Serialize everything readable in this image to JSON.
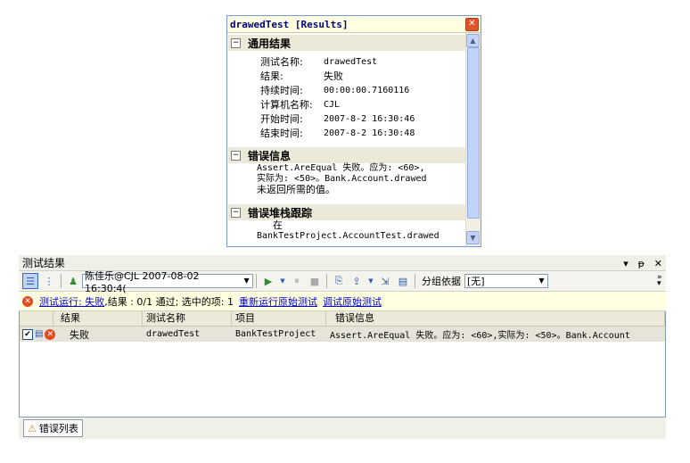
{
  "popup": {
    "title": "drawedTest [Results]",
    "close_glyph": "✕",
    "sections": {
      "general": {
        "title": "通用结果",
        "fields": [
          {
            "k": "测试名称:",
            "v": "drawedTest"
          },
          {
            "k": "结果:",
            "v": "失败"
          },
          {
            "k": "持续时间:",
            "v": "00:00:00.7160116"
          },
          {
            "k": "计算机名称:",
            "v": "CJL"
          },
          {
            "k": "开始时间:",
            "v": "2007-8-2 16:30:46"
          },
          {
            "k": "结束时间:",
            "v": "2007-8-2 16:30:48"
          }
        ]
      },
      "error": {
        "title": "错误信息",
        "line1": "Assert.AreEqual 失败。应为: <60>,",
        "line2": "实际为: <50>。Bank.Account.drawed",
        "line3": "未返回所需的值。"
      },
      "stack": {
        "title": "错误堆栈跟踪",
        "line1": "在",
        "line2": "BankTestProject.AccountTest.drawed"
      }
    }
  },
  "pane": {
    "title": "测试结果",
    "controls": {
      "dropdown": "▾",
      "pin": "ᵽ",
      "close": "✕"
    },
    "toolbar": {
      "run_selector": "陈佳乐@CJL 2007-08-02 16:30:4(",
      "group_by_label": "分组依据",
      "group_by_value": "[无]"
    },
    "status": {
      "run_link": "测试运行: 失败",
      "results_text": ",结果 : 0/1 通过;  选中的项: 1",
      "rerun_link": "重新运行原始测试",
      "debug_link": "调试原始测试"
    },
    "grid": {
      "columns": [
        "结果",
        "测试名称",
        "项目",
        "错误信息"
      ],
      "rows": [
        {
          "result": "失败",
          "name": "drawedTest",
          "project": "BankTestProject",
          "message": "Assert.AreEqual 失败。应为: <60>,实际为: <50>。Bank.Account"
        }
      ]
    },
    "bottom_tab": "错误列表"
  },
  "colors": {
    "accent": "#316ac5",
    "error": "#e14b21",
    "info_bg": "#ffffe1"
  }
}
